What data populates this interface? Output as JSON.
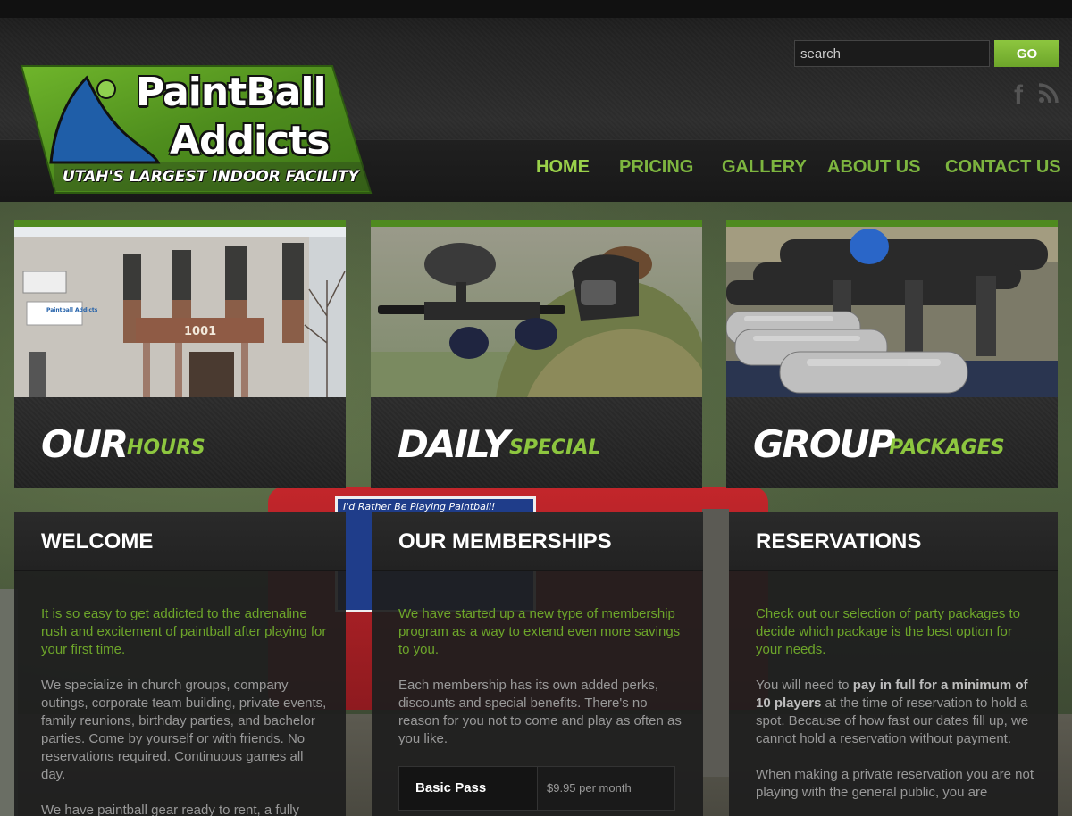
{
  "brand": {
    "line1": "PaintBall",
    "line2": "Addicts",
    "tagline": "UTAH'S LARGEST INDOOR FACILITY",
    "green": "#4f8a1f",
    "accent": "#8dc63f"
  },
  "search": {
    "placeholder": "search",
    "button": "GO"
  },
  "social": [
    {
      "icon": "facebook-icon",
      "label": "f"
    },
    {
      "icon": "rss-icon"
    }
  ],
  "nav": {
    "items": [
      {
        "label": "HOME",
        "active": true
      },
      {
        "label": "PRICING"
      },
      {
        "label": "GALLERY"
      },
      {
        "label": "ABOUT US"
      },
      {
        "label": "CONTACT US"
      }
    ]
  },
  "features": [
    {
      "big": "OUR",
      "small": "HOURS",
      "photo": "building-photo",
      "building_number": "1001",
      "sign": "Paintball Addicts"
    },
    {
      "big": "DAILY",
      "small": "SPECIAL",
      "photo": "player-photo"
    },
    {
      "big": "GROUP",
      "small": "PACKAGES",
      "photo": "markers-photo"
    }
  ],
  "background": {
    "sign_text": "I'd Rather Be Playing Paintball!"
  },
  "columns": {
    "welcome": {
      "title": "WELCOME",
      "intro": "It is so easy to get addicted to the adrenaline rush and excitement of paintball after playing for your first time.",
      "p1": "We specialize in church groups, company outings, corporate team building, private events, family reunions, birthday parties, and bachelor parties. Come by yourself or with friends. No reservations required. Continuous games all day.",
      "p2": "We have paintball gear ready to rent, a fully"
    },
    "memberships": {
      "title": "OUR MEMBERSHIPS",
      "intro": "We have started up a new type of membership program as a way to extend even more savings to you.",
      "p1": "Each membership has its own added perks, discounts and special benefits. There's no reason for you not to come and play as often as you like.",
      "pass_name": "Basic Pass",
      "pass_price": "$9.95 per month"
    },
    "reservations": {
      "title": "RESERVATIONS",
      "intro": "Check out our selection of party packages to decide which package is the best option for your needs.",
      "p1_pre": "You will need to ",
      "p1_bold": "pay in full for a minimum of 10 players",
      "p1_post": " at the time of reservation to hold a spot. Because of how fast our dates fill up, we cannot hold a reservation without payment.",
      "p2": "When making a private reservation you are not playing with the general public, you are"
    }
  }
}
